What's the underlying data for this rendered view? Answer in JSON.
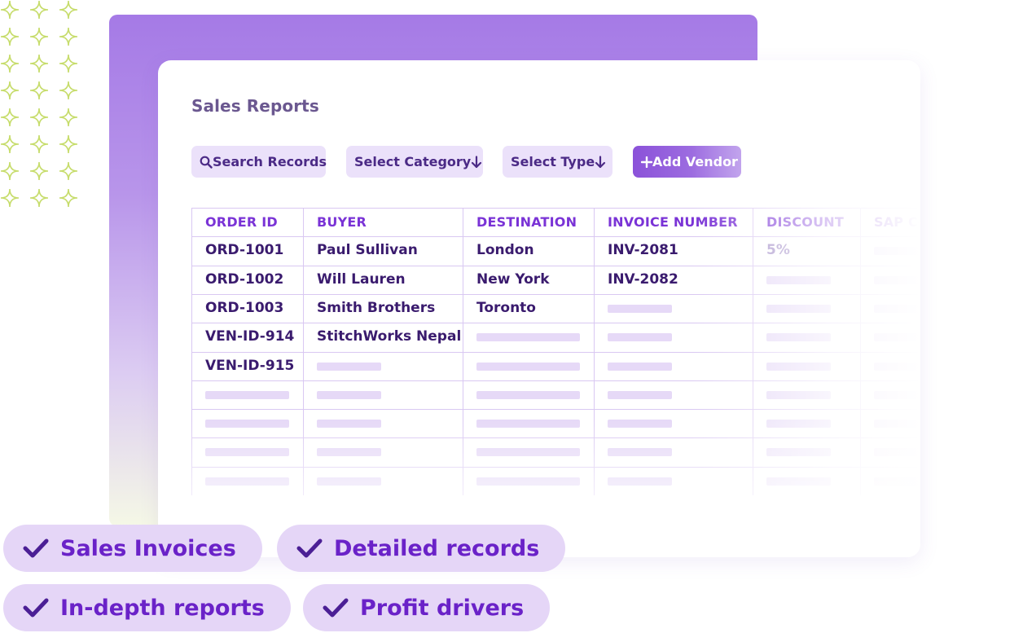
{
  "page": {
    "title": "Sales Reports"
  },
  "toolbar": {
    "search_label": "Search Records",
    "category_label": "Select Category",
    "type_label": "Select Type",
    "add_vendor_label": "Add Vendor"
  },
  "table": {
    "headers": [
      "ORDER ID",
      "BUYER",
      "DESTINATION",
      "INVOICE NUMBER",
      "DISCOUNT",
      "SAP Code"
    ],
    "rows": [
      [
        "ORD-1001",
        "Paul Sullivan",
        "London",
        "INV-2081",
        "5%"
      ],
      [
        "ORD-1002",
        "Will Lauren",
        "New York",
        "INV-2082"
      ],
      [
        "ORD-1003",
        "Smith Brothers",
        "Toronto"
      ],
      [
        "VEN-ID-914",
        "StitchWorks Nepal"
      ],
      [
        "VEN-ID-915"
      ]
    ]
  },
  "chips": [
    "Sales Invoices",
    "Detailed records",
    "In-depth reports",
    "Profit drivers"
  ],
  "colors": {
    "accent": "#7a33d6",
    "chip_bg": "#e5d6f7",
    "chip_text": "#6a22c8",
    "sparkle": "#c6dc6a"
  }
}
